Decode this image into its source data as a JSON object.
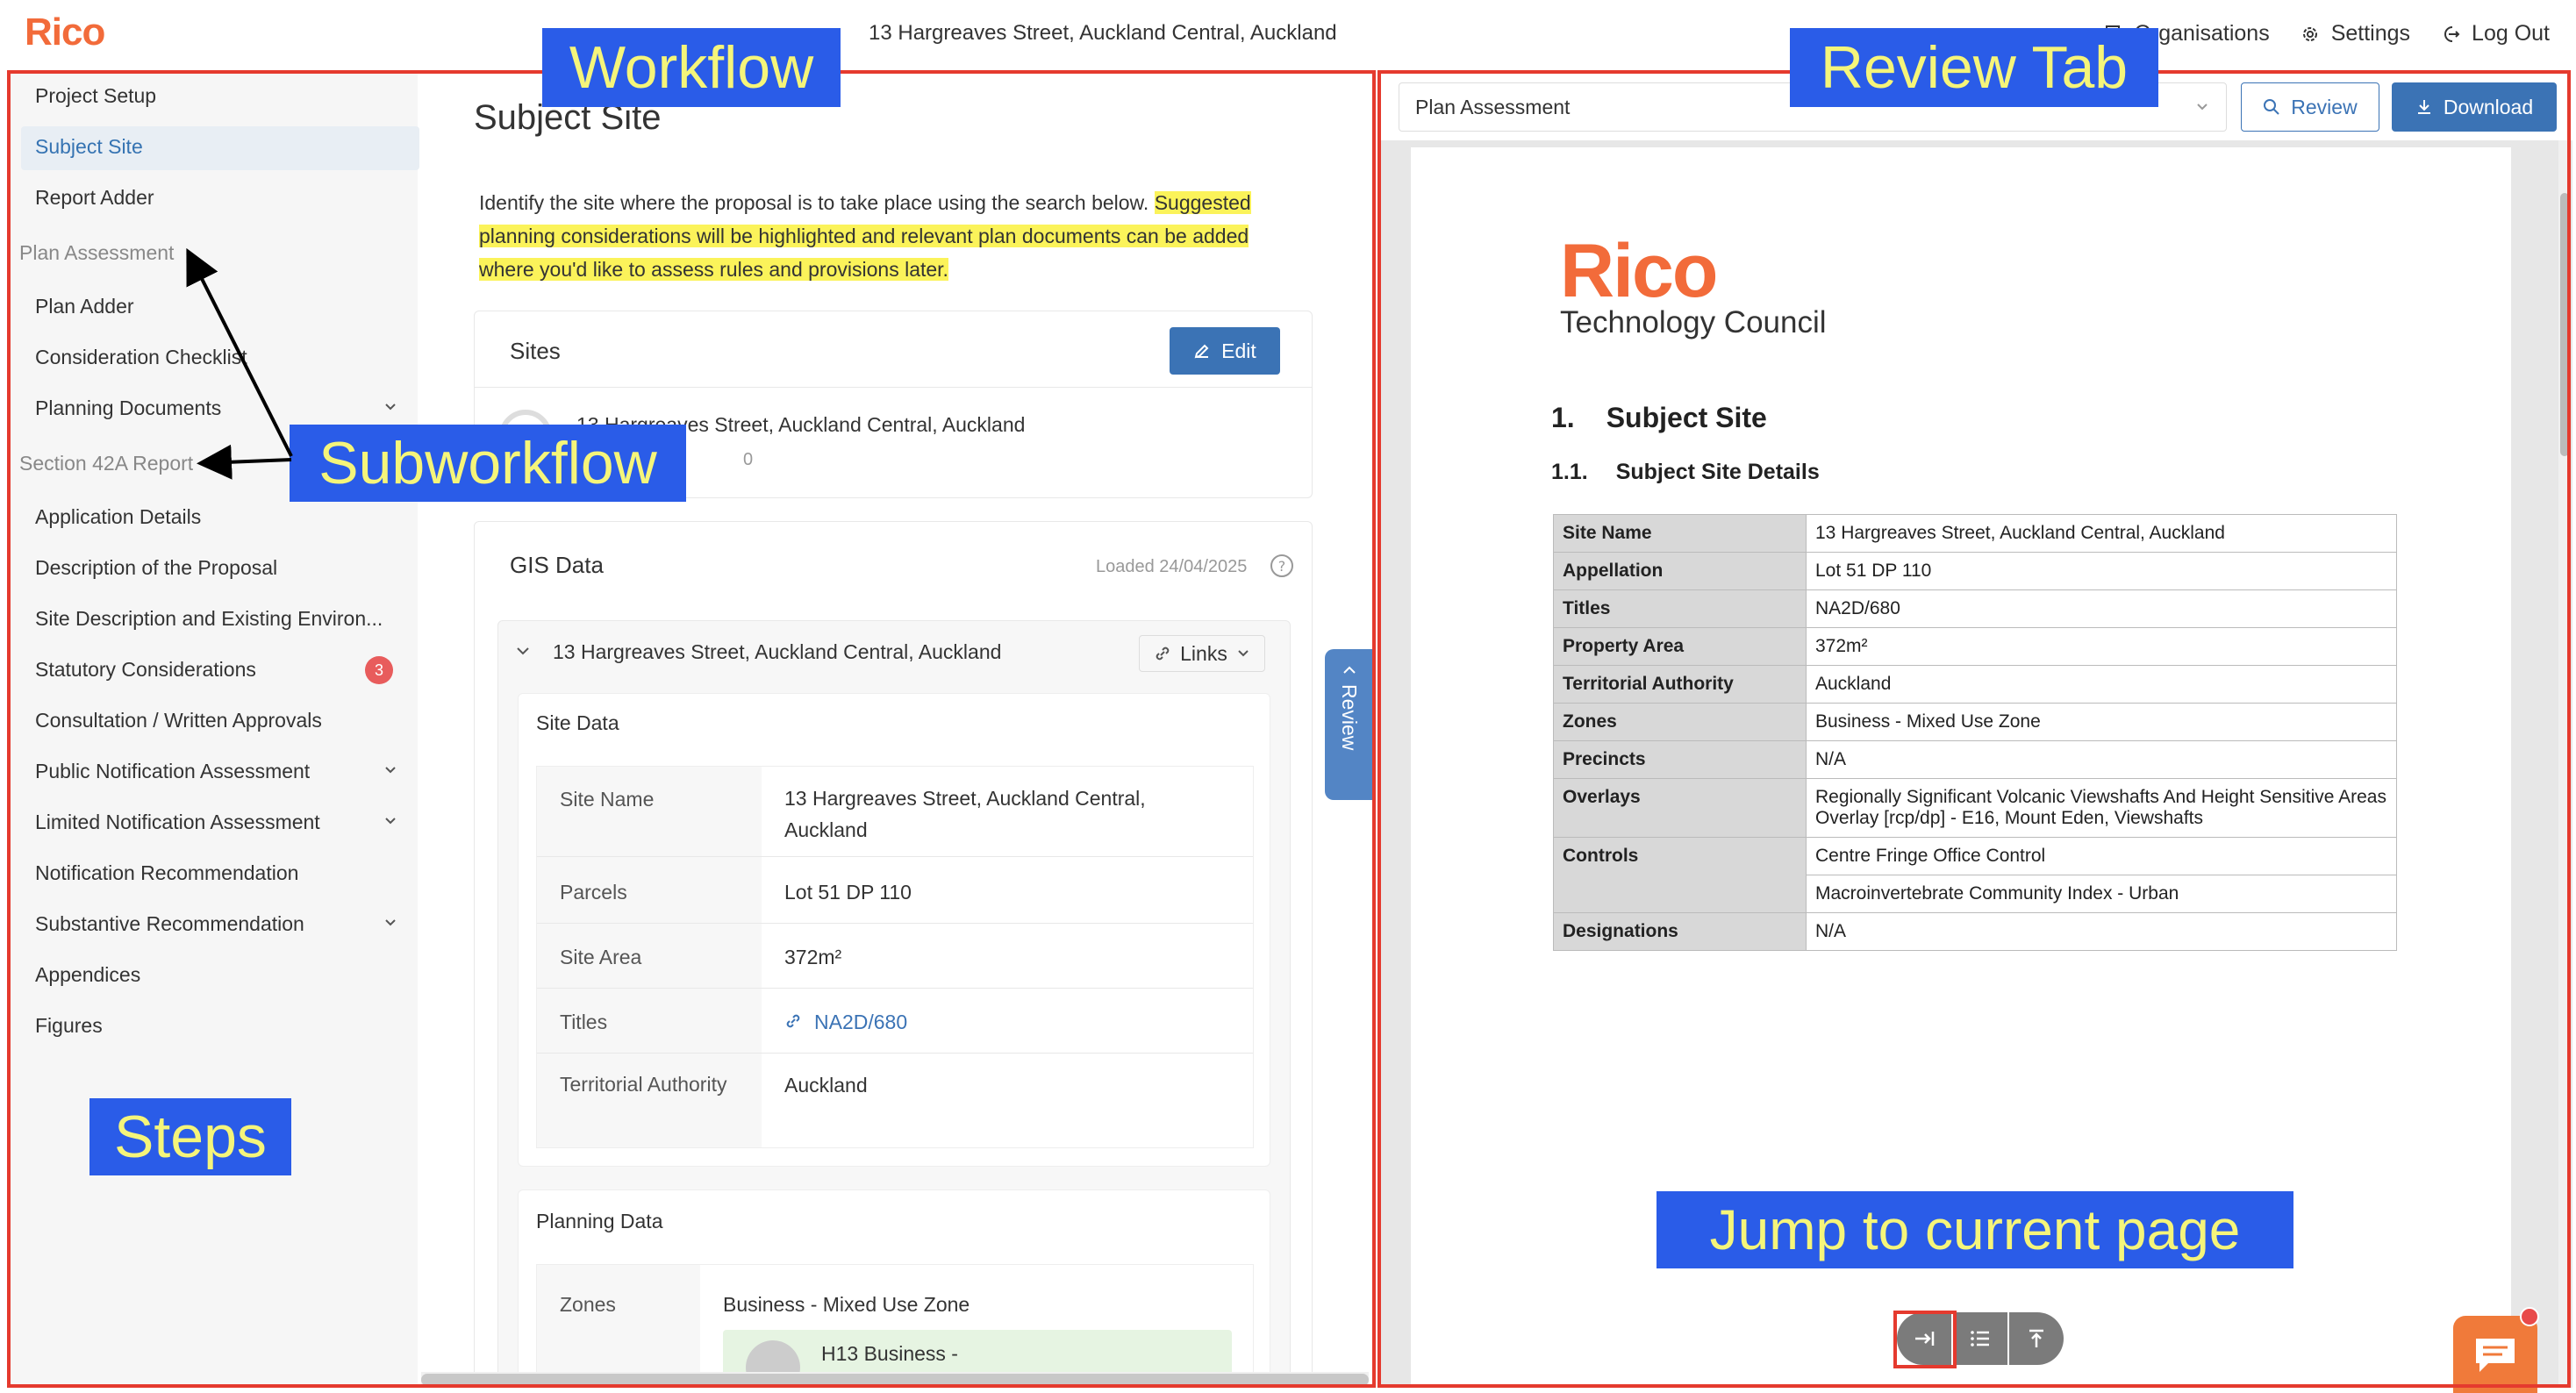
{
  "header": {
    "logo": "Rico",
    "address": "13 Hargreaves Street, Auckland Central, Auckland",
    "nav": [
      {
        "label": "Organisations",
        "icon": "building-icon"
      },
      {
        "label": "Settings",
        "icon": "gear-icon"
      },
      {
        "label": "Log Out",
        "icon": "logout-icon"
      }
    ]
  },
  "sidebar": {
    "items": [
      {
        "label": "Project Setup"
      },
      {
        "label": "Subject Site",
        "active": true
      },
      {
        "label": "Report Adder"
      },
      {
        "section": "Plan Assessment"
      },
      {
        "label": "Plan Adder"
      },
      {
        "label": "Consideration Checklist"
      },
      {
        "label": "Planning Documents",
        "expandable": true
      },
      {
        "section": "Section 42A Report"
      },
      {
        "label": "Application Details"
      },
      {
        "label": "Description of the Proposal"
      },
      {
        "label": "Site Description and Existing Environ..."
      },
      {
        "label": "Statutory Considerations",
        "badge": "3"
      },
      {
        "label": "Consultation / Written Approvals"
      },
      {
        "label": "Public Notification Assessment",
        "expandable": true
      },
      {
        "label": "Limited Notification Assessment",
        "expandable": true
      },
      {
        "label": "Notification Recommendation"
      },
      {
        "label": "Substantive Recommendation",
        "expandable": true
      },
      {
        "label": "Appendices"
      },
      {
        "label": "Figures"
      }
    ]
  },
  "workflow": {
    "title": "Subject Site",
    "intro_plain": "Identify the site where the proposal is to take place using the search below. ",
    "intro_highlight": "Suggested planning considerations will be highlighted and relevant plan documents can be added where you'd like to assess rules and provisions later.",
    "sites": {
      "title": "Sites",
      "edit_label": "Edit",
      "site_address": "13 Hargreaves Street, Auckland Central, Auckland",
      "site_sub": "0"
    },
    "gis": {
      "title": "GIS Data",
      "loaded": "Loaded 24/04/2025",
      "address": "13 Hargreaves Street, Auckland Central, Auckland",
      "links_label": "Links",
      "site_data_title": "Site Data",
      "site_data": [
        {
          "label": "Site Name",
          "value": "13 Hargreaves Street, Auckland Central, Auckland"
        },
        {
          "label": "Parcels",
          "value": "Lot 51 DP 110"
        },
        {
          "label": "Site Area",
          "value": "372m²"
        },
        {
          "label": "Titles",
          "value": "NA2D/680"
        },
        {
          "label": "Territorial Authority",
          "value": "Auckland"
        }
      ],
      "planning_data_title": "Planning Data",
      "zones_label": "Zones",
      "zones_value": "Business - Mixed Use Zone",
      "zone_chip": "H13 Business -"
    }
  },
  "review_tab": {
    "label": "Review"
  },
  "review_panel": {
    "select_value": "Plan Assessment",
    "review_label": "Review",
    "download_label": "Download",
    "doc": {
      "logo": "Rico",
      "council": "Technology Council",
      "h1_num": "1.",
      "h1": "Subject Site",
      "h2_num": "1.1.",
      "h2": "Subject Site Details",
      "rows": [
        {
          "k": "Site Name",
          "v": "13 Hargreaves Street, Auckland Central, Auckland"
        },
        {
          "k": "Appellation",
          "v": "Lot 51 DP 110"
        },
        {
          "k": "Titles",
          "v": "NA2D/680"
        },
        {
          "k": "Property Area",
          "v": "372m²"
        },
        {
          "k": "Territorial Authority",
          "v": "Auckland"
        },
        {
          "k": "Zones",
          "v": "Business - Mixed Use Zone"
        },
        {
          "k": "Precincts",
          "v": "N/A"
        },
        {
          "k": "Overlays",
          "v": "Regionally Significant Volcanic Viewshafts And Height Sensitive Areas Overlay [rcp/dp] - E16, Mount Eden, Viewshafts"
        },
        {
          "k": "Controls",
          "v": "Centre Fringe Office Control"
        },
        {
          "k": "",
          "v": "Macroinvertebrate Community Index - Urban"
        },
        {
          "k": "Designations",
          "v": "N/A"
        }
      ]
    }
  },
  "annotations": {
    "workflow": "Workflow",
    "review_tab": "Review Tab",
    "subworkflow": "Subworkflow",
    "steps": "Steps",
    "jump": "Jump to current page"
  },
  "colors": {
    "brand": "#f26b3a",
    "primary": "#3b73b5",
    "annotation_border": "#e53a2e",
    "callout_bg": "#2a5ce8",
    "callout_text": "#f5f57a",
    "highlight": "#fbf35a"
  }
}
